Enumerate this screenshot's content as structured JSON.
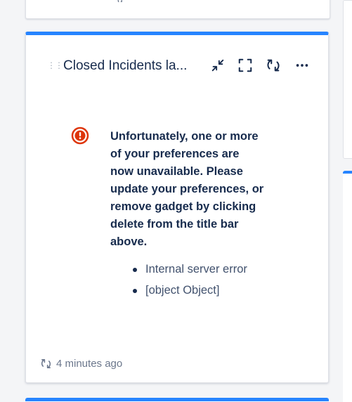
{
  "previous_card": {
    "text_fragment": "g"
  },
  "gadget": {
    "title": "Closed Incidents la...",
    "toolbar": {
      "minimize_icon": "collapse-arrows-icon",
      "fullscreen_icon": "fullscreen-icon",
      "refresh_icon": "refresh-icon",
      "more_icon": "more-icon"
    },
    "error": {
      "icon": "error-circle-icon",
      "message": "Unfortunately, one or more of your preferences are now unavailable. Please update your preferences, or remove gadget by clicking delete from the title bar above.",
      "details": [
        "Internal server error",
        "[object Object]"
      ]
    },
    "footer": {
      "refresh_icon": "refresh-icon",
      "updated": "4 minutes ago"
    }
  },
  "colors": {
    "accent": "#2684ff",
    "error": "#de350b",
    "text_primary": "#172b4d",
    "text_secondary": "#6b778c"
  }
}
